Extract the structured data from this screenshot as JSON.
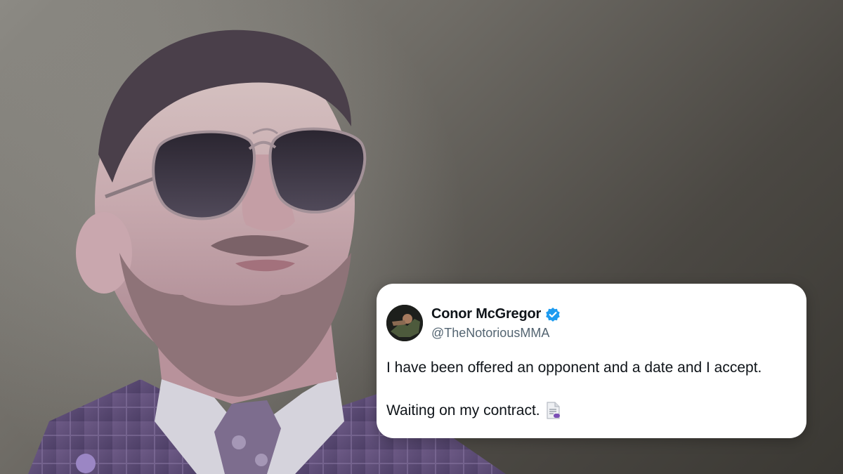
{
  "tweet": {
    "display_name": "Conor McGregor",
    "handle": "@TheNotoriousMMA",
    "verified": true,
    "text_lines": [
      "I have been offered an opponent and a date and I accept.",
      "Waiting on my contract."
    ],
    "trailing_emoji": "page-facing-up-icon"
  },
  "colors": {
    "verified_badge": "#1d9bf0",
    "name_text": "#0f1419",
    "handle_text": "#536471",
    "card_background": "#ffffff",
    "photo_tint": "#6b4f8a"
  }
}
